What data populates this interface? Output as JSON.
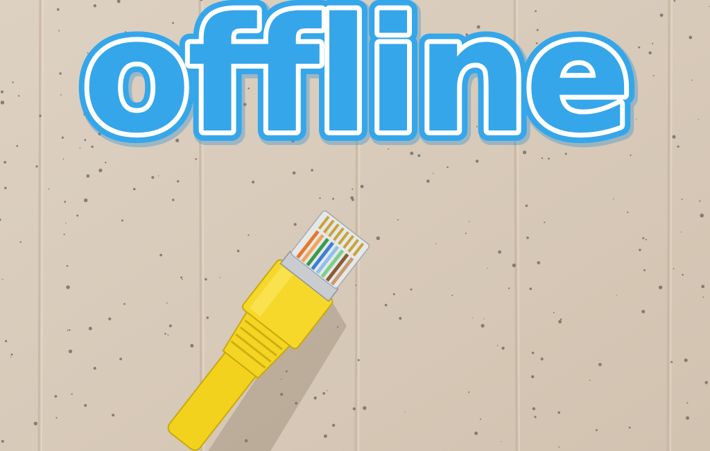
{
  "headline": {
    "text": "offline"
  },
  "colors": {
    "wall": "#d9ccbc",
    "wall_dark": "#c8b8a5",
    "text_fill": "#ffffff",
    "text_outline": "#35a6ea",
    "cable": "#f2d21d",
    "cable_dark": "#caa80b",
    "connector_clear": "#e8eef0"
  },
  "icons": {
    "cable": "ethernet-cable-icon"
  }
}
